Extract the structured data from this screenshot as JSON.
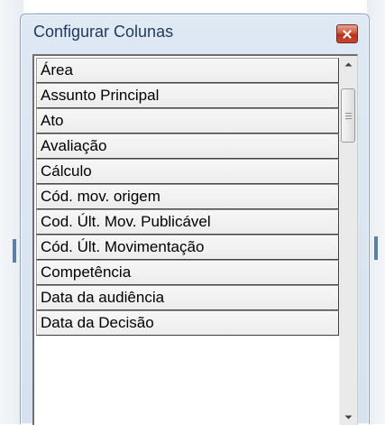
{
  "dialog": {
    "title": "Configurar Colunas"
  },
  "columns": [
    "Área",
    "Assunto Principal",
    "Ato",
    "Avaliação",
    "Cálculo",
    "Cód. mov. origem",
    "Cod. Últ. Mov. Publicável",
    "Cód. Últ. Movimentação",
    "Competência",
    "Data da audiência",
    "Data da Decisão"
  ],
  "icons": {
    "close": "close-icon",
    "scroll_up": "arrow-up-icon",
    "scroll_down": "arrow-down-icon",
    "thumb_grip": "grip-icon"
  },
  "colors": {
    "title_text": "#1e395b",
    "close_button": "#c7492c"
  }
}
